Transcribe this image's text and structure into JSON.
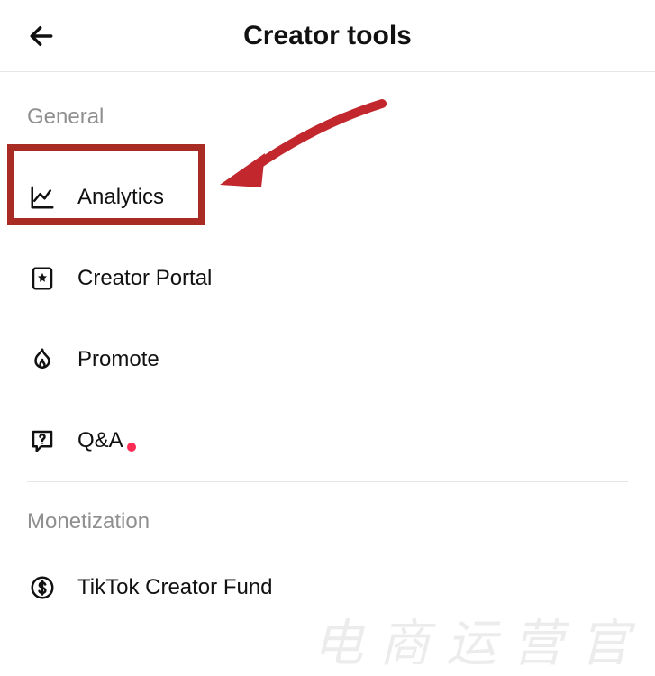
{
  "header": {
    "title": "Creator tools"
  },
  "sections": {
    "general": {
      "label": "General",
      "items": [
        {
          "label": "Analytics",
          "icon": "analytics"
        },
        {
          "label": "Creator Portal",
          "icon": "portal"
        },
        {
          "label": "Promote",
          "icon": "promote"
        },
        {
          "label": "Q&A",
          "icon": "qa",
          "has_dot": true
        }
      ]
    },
    "monetization": {
      "label": "Monetization",
      "items": [
        {
          "label": "TikTok Creator Fund",
          "icon": "fund"
        }
      ]
    }
  },
  "annotations": {
    "highlighted_item": "Analytics",
    "arrow": true,
    "highlight_color": "#a82c24"
  },
  "watermark": "电商运营官"
}
